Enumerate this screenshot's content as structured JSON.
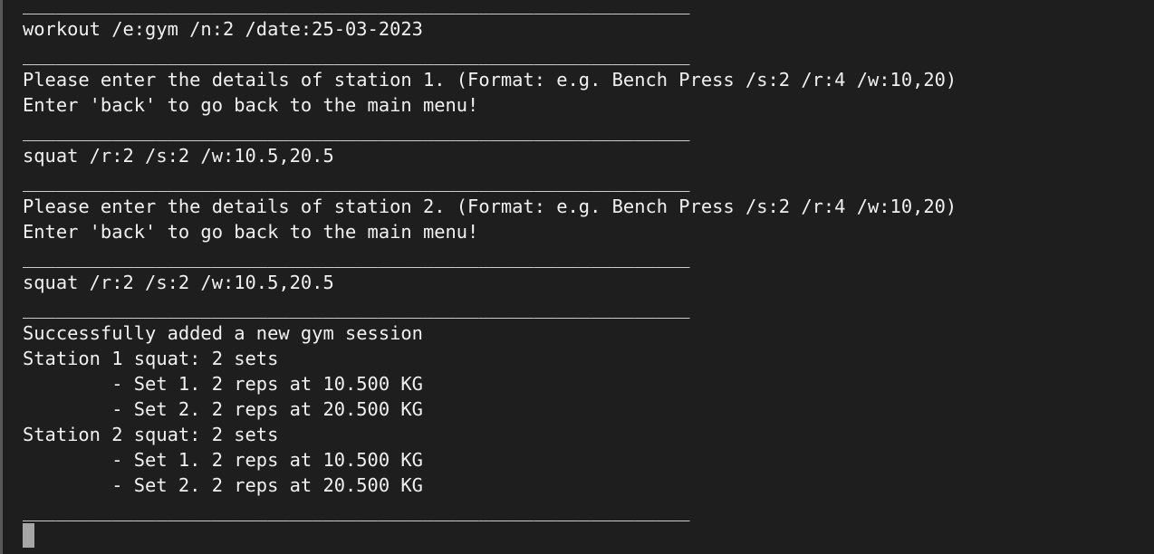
{
  "terminal": {
    "lines": [
      "____________________________________________________________",
      "workout /e:gym /n:2 /date:25-03-2023",
      "____________________________________________________________",
      "Please enter the details of station 1. (Format: e.g. Bench Press /s:2 /r:4 /w:10,20)",
      "Enter 'back' to go back to the main menu!",
      "____________________________________________________________",
      "squat /r:2 /s:2 /w:10.5,20.5",
      "____________________________________________________________",
      "Please enter the details of station 2. (Format: e.g. Bench Press /s:2 /r:4 /w:10,20)",
      "Enter 'back' to go back to the main menu!",
      "____________________________________________________________",
      "squat /r:2 /s:2 /w:10.5,20.5",
      "____________________________________________________________",
      "Successfully added a new gym session",
      "Station 1 squat: 2 sets",
      "        - Set 1. 2 reps at 10.500 KG",
      "        - Set 2. 2 reps at 20.500 KG",
      "Station 2 squat: 2 sets",
      "        - Set 1. 2 reps at 10.500 KG",
      "        - Set 2. 2 reps at 20.500 KG",
      "____________________________________________________________"
    ]
  }
}
